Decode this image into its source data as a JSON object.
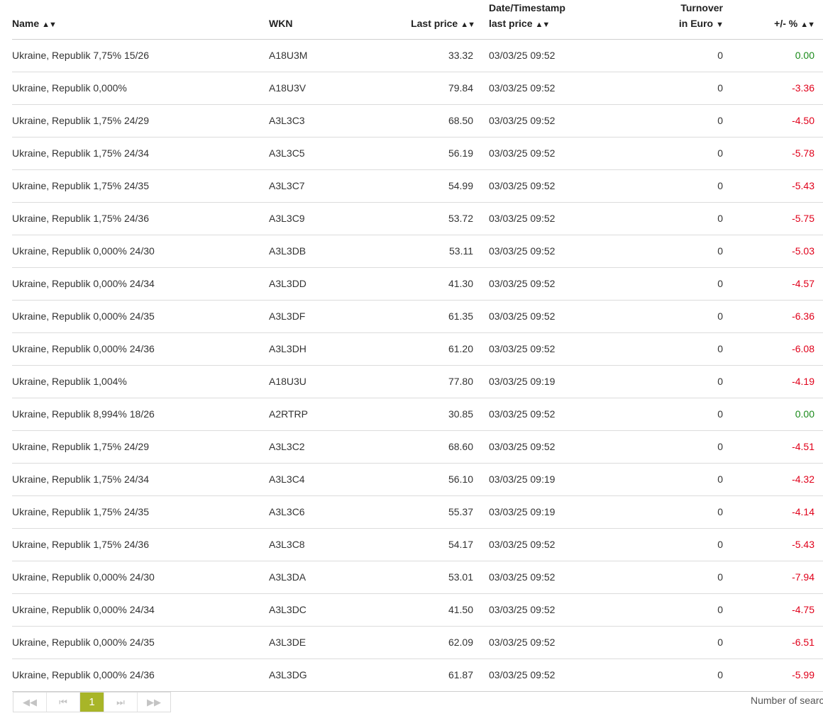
{
  "columns": {
    "name": "Name",
    "wkn": "WKN",
    "last_price": "Last price",
    "date_line1": "Date/Timestamp",
    "date_line2": "last price",
    "turnover_line1": "Turnover",
    "turnover_line2": "in Euro",
    "change": "+/- %"
  },
  "sort_icons": {
    "both": "▲▼",
    "down": "▼"
  },
  "rows": [
    {
      "name": "Ukraine, Republik 7,75% 15/26",
      "wkn": "A18U3M",
      "price": "33.32",
      "date": "03/03/25 09:52",
      "turnover": "0",
      "change": "0.00",
      "dir": "pos"
    },
    {
      "name": "Ukraine, Republik 0,000%",
      "wkn": "A18U3V",
      "price": "79.84",
      "date": "03/03/25 09:52",
      "turnover": "0",
      "change": "-3.36",
      "dir": "neg"
    },
    {
      "name": "Ukraine, Republik 1,75% 24/29",
      "wkn": "A3L3C3",
      "price": "68.50",
      "date": "03/03/25 09:52",
      "turnover": "0",
      "change": "-4.50",
      "dir": "neg"
    },
    {
      "name": "Ukraine, Republik 1,75% 24/34",
      "wkn": "A3L3C5",
      "price": "56.19",
      "date": "03/03/25 09:52",
      "turnover": "0",
      "change": "-5.78",
      "dir": "neg"
    },
    {
      "name": "Ukraine, Republik 1,75% 24/35",
      "wkn": "A3L3C7",
      "price": "54.99",
      "date": "03/03/25 09:52",
      "turnover": "0",
      "change": "-5.43",
      "dir": "neg"
    },
    {
      "name": "Ukraine, Republik 1,75% 24/36",
      "wkn": "A3L3C9",
      "price": "53.72",
      "date": "03/03/25 09:52",
      "turnover": "0",
      "change": "-5.75",
      "dir": "neg"
    },
    {
      "name": "Ukraine, Republik 0,000% 24/30",
      "wkn": "A3L3DB",
      "price": "53.11",
      "date": "03/03/25 09:52",
      "turnover": "0",
      "change": "-5.03",
      "dir": "neg"
    },
    {
      "name": "Ukraine, Republik 0,000% 24/34",
      "wkn": "A3L3DD",
      "price": "41.30",
      "date": "03/03/25 09:52",
      "turnover": "0",
      "change": "-4.57",
      "dir": "neg"
    },
    {
      "name": "Ukraine, Republik 0,000% 24/35",
      "wkn": "A3L3DF",
      "price": "61.35",
      "date": "03/03/25 09:52",
      "turnover": "0",
      "change": "-6.36",
      "dir": "neg"
    },
    {
      "name": "Ukraine, Republik 0,000% 24/36",
      "wkn": "A3L3DH",
      "price": "61.20",
      "date": "03/03/25 09:52",
      "turnover": "0",
      "change": "-6.08",
      "dir": "neg"
    },
    {
      "name": "Ukraine, Republik 1,004%",
      "wkn": "A18U3U",
      "price": "77.80",
      "date": "03/03/25 09:19",
      "turnover": "0",
      "change": "-4.19",
      "dir": "neg"
    },
    {
      "name": "Ukraine, Republik 8,994% 18/26",
      "wkn": "A2RTRP",
      "price": "30.85",
      "date": "03/03/25 09:52",
      "turnover": "0",
      "change": "0.00",
      "dir": "pos"
    },
    {
      "name": "Ukraine, Republik 1,75% 24/29",
      "wkn": "A3L3C2",
      "price": "68.60",
      "date": "03/03/25 09:52",
      "turnover": "0",
      "change": "-4.51",
      "dir": "neg"
    },
    {
      "name": "Ukraine, Republik 1,75% 24/34",
      "wkn": "A3L3C4",
      "price": "56.10",
      "date": "03/03/25 09:19",
      "turnover": "0",
      "change": "-4.32",
      "dir": "neg"
    },
    {
      "name": "Ukraine, Republik 1,75% 24/35",
      "wkn": "A3L3C6",
      "price": "55.37",
      "date": "03/03/25 09:19",
      "turnover": "0",
      "change": "-4.14",
      "dir": "neg"
    },
    {
      "name": "Ukraine, Republik 1,75% 24/36",
      "wkn": "A3L3C8",
      "price": "54.17",
      "date": "03/03/25 09:52",
      "turnover": "0",
      "change": "-5.43",
      "dir": "neg"
    },
    {
      "name": "Ukraine, Republik 0,000% 24/30",
      "wkn": "A3L3DA",
      "price": "53.01",
      "date": "03/03/25 09:52",
      "turnover": "0",
      "change": "-7.94",
      "dir": "neg"
    },
    {
      "name": "Ukraine, Republik 0,000% 24/34",
      "wkn": "A3L3DC",
      "price": "41.50",
      "date": "03/03/25 09:52",
      "turnover": "0",
      "change": "-4.75",
      "dir": "neg"
    },
    {
      "name": "Ukraine, Republik 0,000% 24/35",
      "wkn": "A3L3DE",
      "price": "62.09",
      "date": "03/03/25 09:52",
      "turnover": "0",
      "change": "-6.51",
      "dir": "neg"
    },
    {
      "name": "Ukraine, Republik 0,000% 24/36",
      "wkn": "A3L3DG",
      "price": "61.87",
      "date": "03/03/25 09:52",
      "turnover": "0",
      "change": "-5.99",
      "dir": "neg"
    }
  ],
  "pager": {
    "first": "◀◀",
    "prev": "⏮",
    "current_page": "1",
    "next": "⏭",
    "last": "▶▶"
  },
  "footer": {
    "results_label": "Number of searc"
  },
  "colors": {
    "positive": "#1a8a1a",
    "negative": "#e0001a",
    "pager_active": "#a8b528"
  }
}
